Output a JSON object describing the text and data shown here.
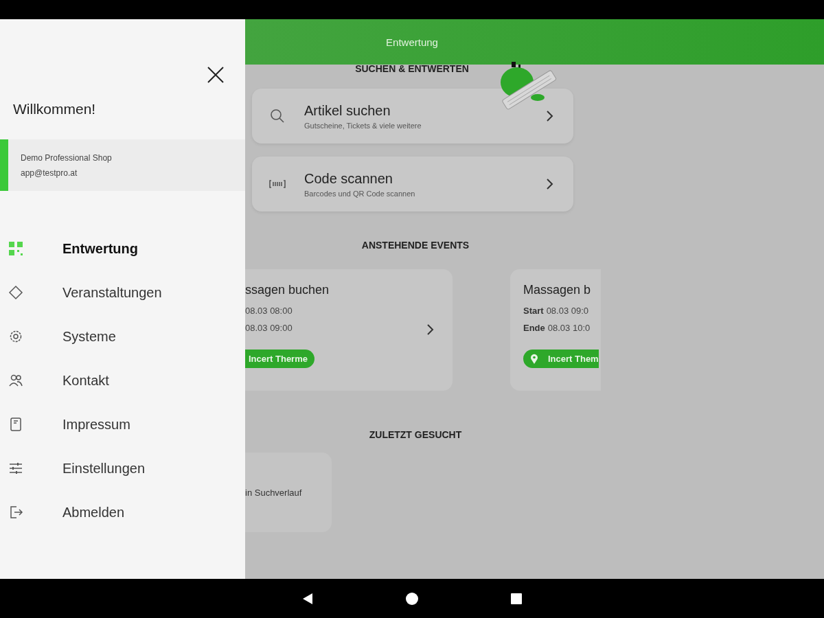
{
  "app_bar": {
    "title": "Entwertung"
  },
  "drawer": {
    "greeting": "Willkommen!",
    "account": {
      "shop": "Demo Professional Shop",
      "email": "app@testpro.at"
    },
    "items": [
      {
        "label": "Entwertung",
        "selected": true
      },
      {
        "label": "Veranstaltungen",
        "selected": false
      },
      {
        "label": "Systeme",
        "selected": false
      },
      {
        "label": "Kontakt",
        "selected": false
      },
      {
        "label": "Impressum",
        "selected": false
      },
      {
        "label": "Einstellungen",
        "selected": false
      },
      {
        "label": "Abmelden",
        "selected": false
      }
    ]
  },
  "search_section": {
    "heading": "SUCHEN & ENTWERTEN",
    "actions": [
      {
        "title": "Artikel suchen",
        "subtitle": "Gutscheine, Tickets & viele weitere"
      },
      {
        "title": "Code scannen",
        "subtitle": "Barcodes und QR Code scannen"
      }
    ]
  },
  "events_section": {
    "heading": "ANSTEHENDE EVENTS",
    "events": [
      {
        "title": "ssagen buchen",
        "start_value": "08.03 08:00",
        "end_value": "08.03 09:00",
        "location": "Incert Therme"
      },
      {
        "title": "Massagen b",
        "start_label": "Start",
        "start_value": "08.03 09:0",
        "end_label": "Ende",
        "end_value": "08.03 10:0",
        "location": "Incert Them"
      }
    ]
  },
  "recent_section": {
    "heading": "ZULETZT GESUCHT",
    "empty_text": "in Suchverlauf"
  }
}
